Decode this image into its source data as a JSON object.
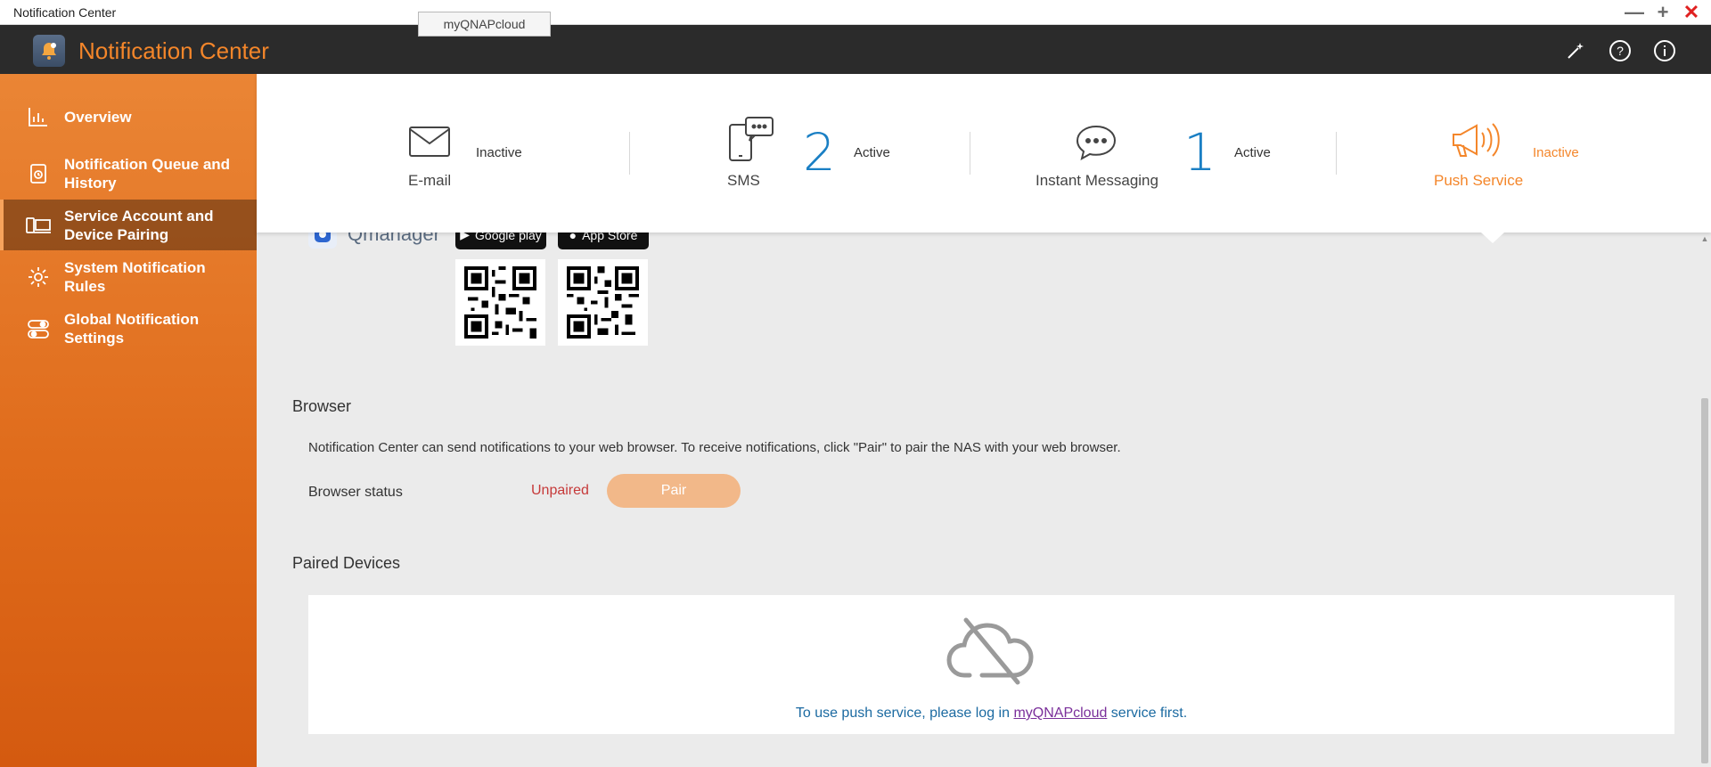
{
  "window": {
    "title": "Notification Center",
    "minimize": "—",
    "maximize": "+",
    "close": "✕"
  },
  "tooltip_tab": "myQNAPcloud",
  "header": {
    "title": "Notification Center"
  },
  "sidebar": {
    "items": [
      {
        "label": "Overview",
        "icon": "chart-icon"
      },
      {
        "label": "Notification Queue and History",
        "icon": "history-icon"
      },
      {
        "label": "Service Account and Device Pairing",
        "icon": "device-pairing-icon",
        "active": true
      },
      {
        "label": "System Notification Rules",
        "icon": "gear-icon"
      },
      {
        "label": "Global Notification Settings",
        "icon": "toggle-icon"
      }
    ]
  },
  "services": {
    "email": {
      "label": "E-mail",
      "state": "Inactive"
    },
    "sms": {
      "label": "SMS",
      "count": "2",
      "state": "Active"
    },
    "im": {
      "label": "Instant Messaging",
      "count": "1",
      "state": "Active"
    },
    "push": {
      "label": "Push Service",
      "state": "Inactive"
    }
  },
  "qmanager": {
    "name": "Qmanager",
    "google_play": "Google play",
    "app_store": "App Store"
  },
  "browser": {
    "title": "Browser",
    "description": "Notification Center can send notifications to your web browser. To receive notifications, click \"Pair\" to pair the NAS with your web browser.",
    "status_label": "Browser status",
    "status_value": "Unpaired",
    "pair_button": "Pair"
  },
  "paired_devices": {
    "title": "Paired Devices",
    "msg_before": "To use push service, please log in ",
    "msg_link": "myQNAPcloud",
    "msg_after": " service first."
  },
  "colors": {
    "accent": "#f4862a",
    "header_bg": "#2b2b2b",
    "active_blue": "#1a7fc4",
    "unpaired_red": "#c63a3a"
  }
}
